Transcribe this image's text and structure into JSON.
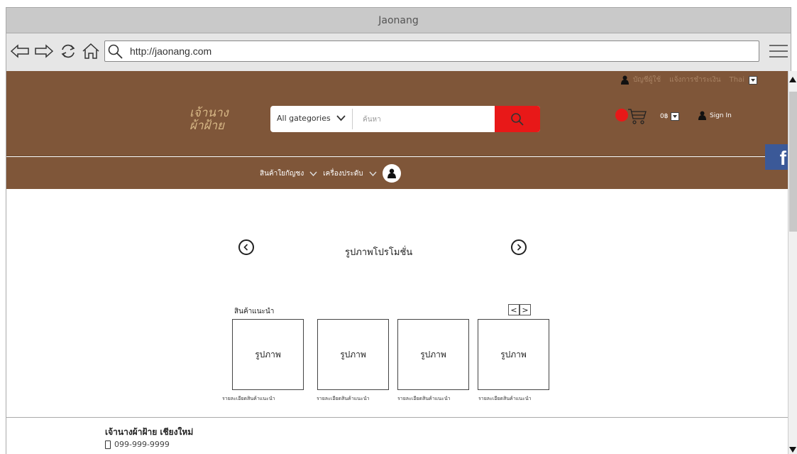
{
  "browser": {
    "title": "Jaonang",
    "url": "http://jaonang.com"
  },
  "topstrip": {
    "account": "บัญชีผู้ใช้",
    "payment": "แจ้งการชำระเงิน",
    "language": "Thai"
  },
  "header": {
    "logo_line1": "เจ้านาง",
    "logo_line2": "ผ้าฝ้าย",
    "category_label": "All gategories",
    "search_placeholder": "ค้นหา",
    "money": "0฿",
    "sign_in": "Sign In"
  },
  "nav": {
    "items": [
      "สินค้าใยกัญชง",
      "เครื่องประดับ"
    ]
  },
  "promo": {
    "label": "รูปภาพโปรโมชั่น"
  },
  "recommended": {
    "title": "สินค้าแนะนำ",
    "pager_prev": "<",
    "pager_next": ">",
    "cards": [
      {
        "image_label": "รูปภาพ",
        "caption": "รายละเอียดสินค้าแนะนำ"
      },
      {
        "image_label": "รูปภาพ",
        "caption": "รายละเอียดสินค้าแนะนำ"
      },
      {
        "image_label": "รูปภาพ",
        "caption": "รายละเอียดสินค้าแนะนำ"
      },
      {
        "image_label": "รูปภาพ",
        "caption": "รายละเอียดสินค้าแนะนำ"
      }
    ]
  },
  "footer": {
    "name": "เจ้านางผ้าฝ้าย เชียงใหม่",
    "phone": "099-999-9999"
  },
  "social": {
    "facebook": "f"
  },
  "colors": {
    "brand_brown": "#7f5639",
    "accent_red": "#e81818",
    "logo_gold": "#d7b786",
    "facebook_blue": "#3b5998"
  }
}
